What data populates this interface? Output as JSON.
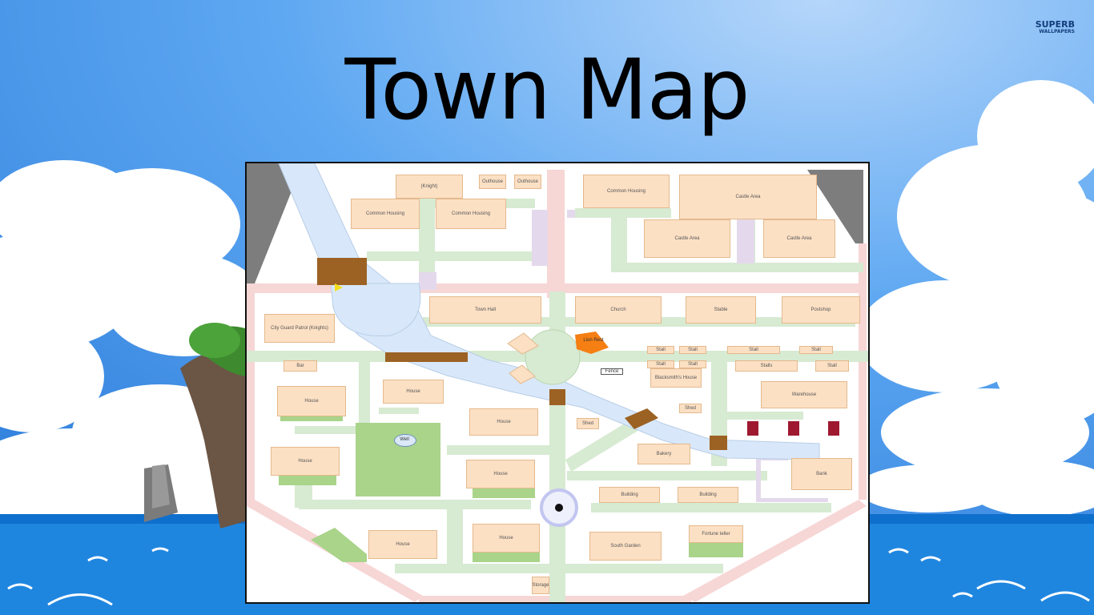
{
  "slide": {
    "title": "Town Map",
    "watermark_line1": "SUPERB",
    "watermark_line2": "WALLPAPERS"
  },
  "colors": {
    "sky": "#4f9ef0",
    "sky_light": "#9cc9f6",
    "cloud": "#ffffff",
    "sea": "#1f86e0",
    "building": "#fce0c4",
    "road": "#d7ead2",
    "border_road": "#f7d6d6",
    "river": "#d8e8fa",
    "bridge": "#9c6224",
    "grass": "#a9d48a",
    "mountain": "#808080"
  },
  "map": {
    "buildings": {
      "knight": "(Knight)",
      "outhouse1": "Outhouse",
      "outhouse2": "Outhouse",
      "common_housing_1": "Common Housing",
      "common_housing_2": "Common Housing",
      "common_housing_3": "Common Housing",
      "castle_area_top": "Castle Area",
      "castle_area_left": "Castle Area",
      "castle_area_right": "Castle Area",
      "city_guard": "City Guard Patrol (Knights)",
      "town_hall": "Town Hall",
      "church": "Church",
      "stable": "Stable",
      "postshop": "Postshop",
      "stall1": "Stall",
      "stall2": "Stall",
      "stall3": "Stall",
      "stall4": "Stall",
      "stall5": "Stall",
      "stall6": "Stall",
      "stall7": "Stall",
      "stalls_row": "Stalls",
      "house_w1": "House",
      "house_w2": "House",
      "house_c1": "House",
      "house_c2": "House",
      "house_c3": "House",
      "house_s1": "House",
      "house_s2": "House",
      "blacksmith": "Blacksmith's House",
      "warehouse": "Warehouse",
      "shed1": "Shed",
      "shed2": "Shed",
      "bakery": "Bakery",
      "building1": "Building",
      "building2": "Building",
      "fortune_teller": "Fortune teller",
      "south_garden": "South Garden",
      "small_south": "Storage",
      "well": "Well",
      "fence": "Fence",
      "orange_sign": "Lion Rest",
      "bar": "Bar",
      "bank": "Bank"
    }
  }
}
